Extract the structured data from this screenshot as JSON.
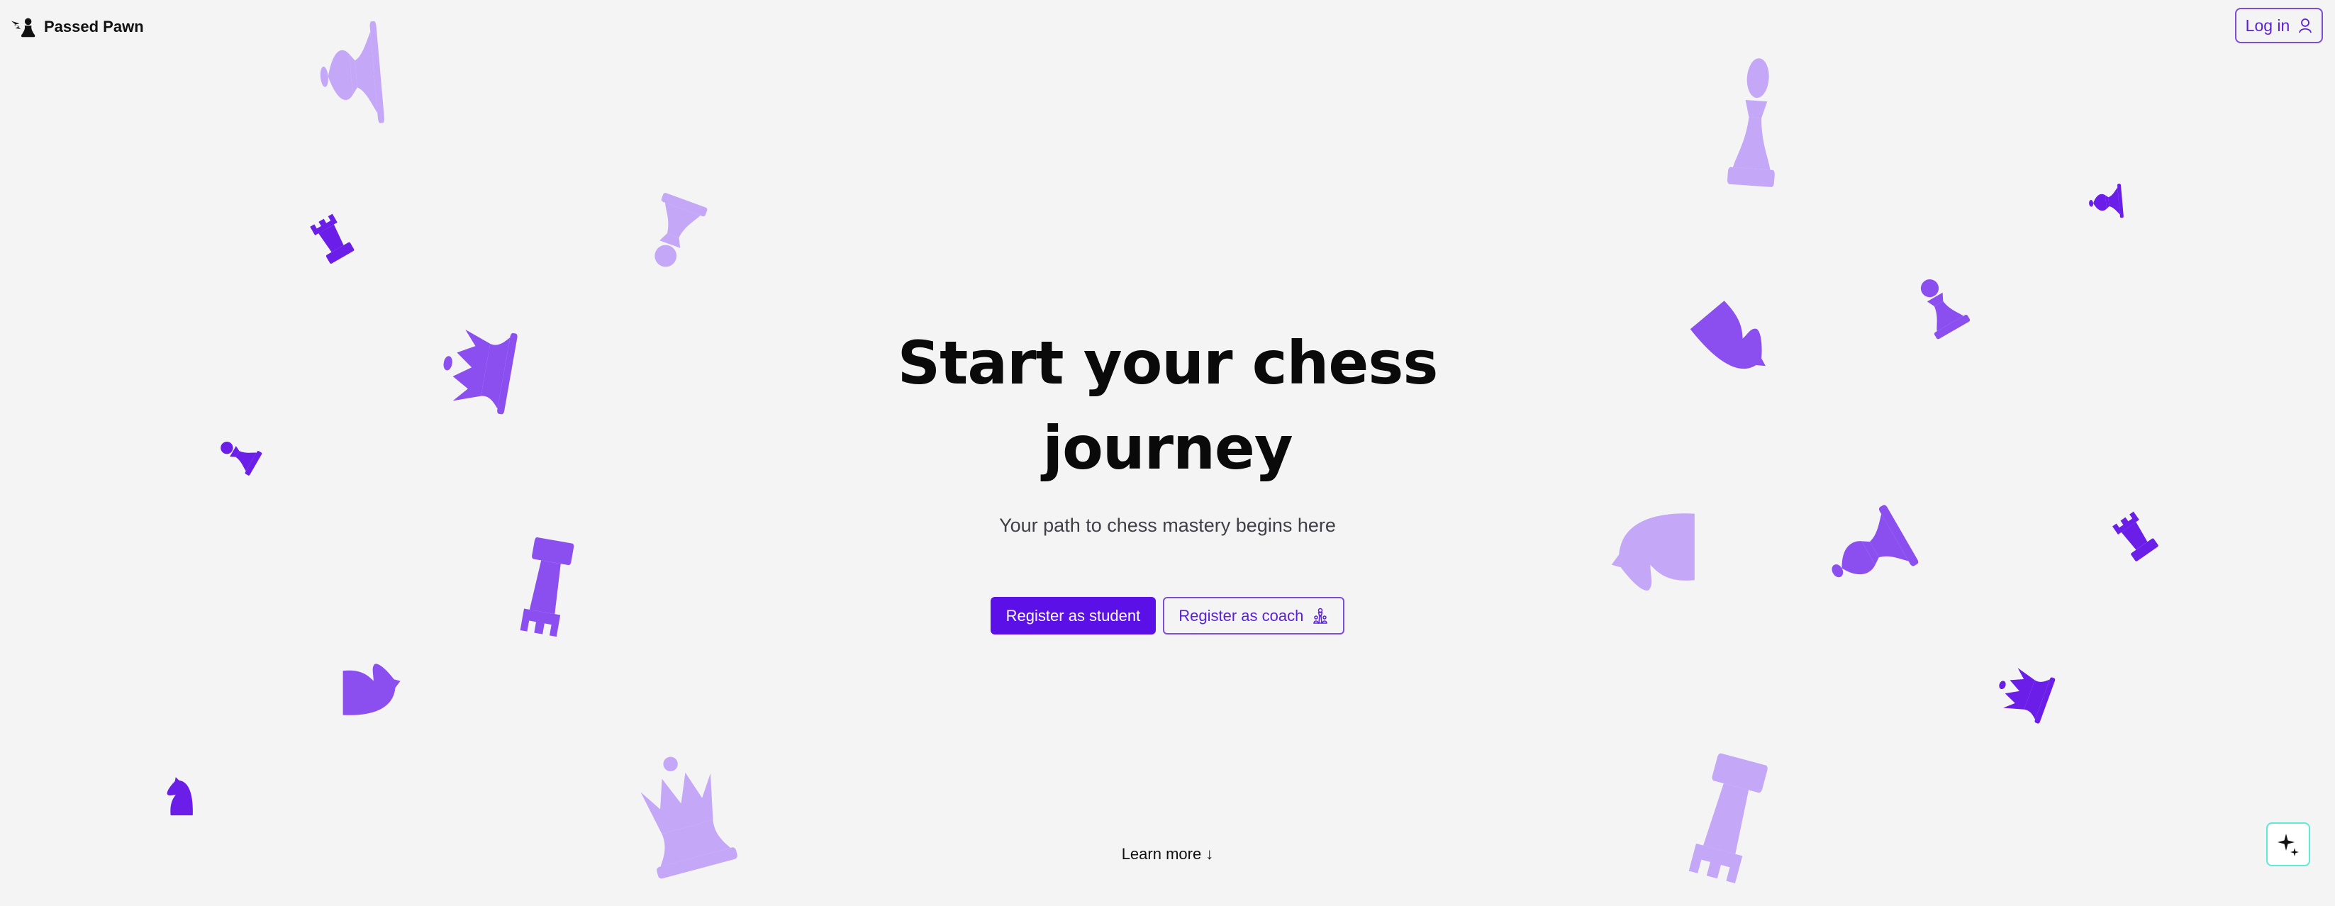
{
  "header": {
    "brand": "Passed Pawn",
    "login_label": "Log in",
    "logo_icon": "pawn-with-wing-icon",
    "login_icon": "user-icon"
  },
  "hero": {
    "heading_line1": "Start your chess",
    "heading_line2": "journey",
    "subtitle": "Your path to chess mastery begins here",
    "register_student_label": "Register as student",
    "register_coach_label": "Register as coach",
    "coach_icon": "chess-pieces-icon"
  },
  "footer": {
    "learn_more_label": "Learn more ↓",
    "assistant_icon": "sparkle-icon"
  },
  "colors": {
    "background": "#f4f4f5",
    "accent": "#5b10e8",
    "piece_light": "#c4a7f7",
    "piece_mid": "#8b4ff0",
    "piece_dark": "#6a1ee8"
  }
}
